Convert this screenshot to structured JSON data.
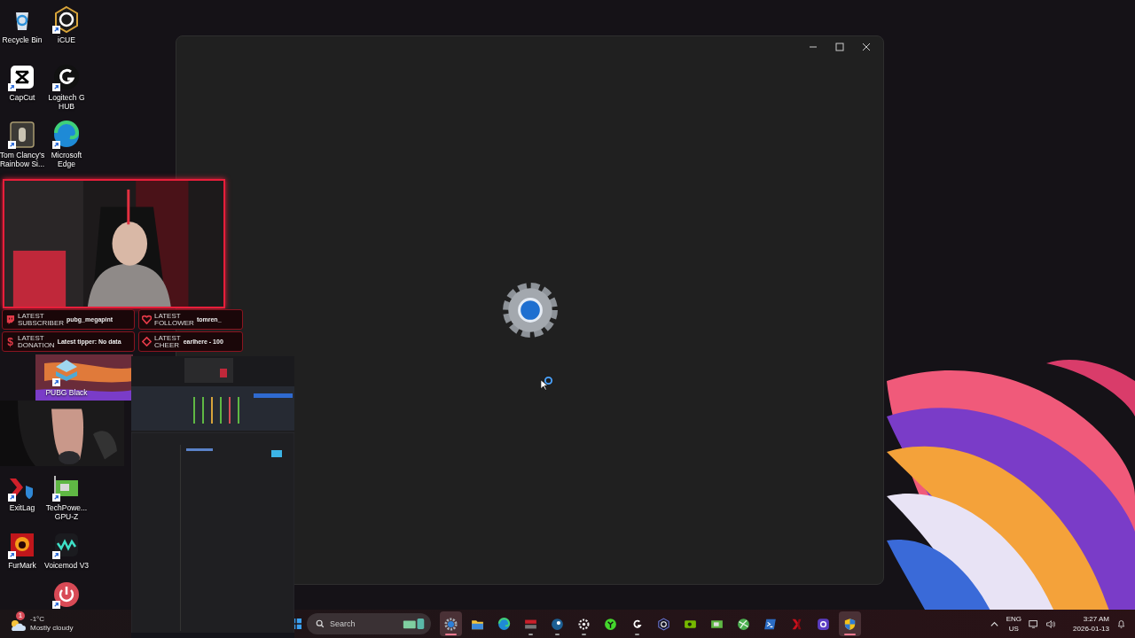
{
  "desktop_icons_top": [
    {
      "label": "Recycle Bin",
      "shortcut": false
    },
    {
      "label": "iCUE",
      "shortcut": true
    },
    {
      "label": "CapCut",
      "shortcut": true
    },
    {
      "label": "Logitech G HUB",
      "shortcut": true
    },
    {
      "label": "Tom Clancy's Rainbow Si...",
      "shortcut": true
    },
    {
      "label": "Microsoft Edge",
      "shortcut": true
    }
  ],
  "desktop_icons_bottom": [
    {
      "label": "PUBG Black",
      "shortcut": true
    },
    {
      "label": "ExitLag",
      "shortcut": true
    },
    {
      "label": "TechPowe... GPU-Z",
      "shortcut": true
    },
    {
      "label": "FurMark",
      "shortcut": true
    },
    {
      "label": "Voicemod V3",
      "shortcut": true
    },
    {
      "shortcut": true
    }
  ],
  "stream_overlay": {
    "stats": [
      {
        "kind": "twitch",
        "label": "LATEST",
        "sublabel": "SUBSCRIBER",
        "value": "pubg_megapint"
      },
      {
        "kind": "heart",
        "label": "LATEST",
        "sublabel": "FOLLOWER",
        "value": "tomren_"
      },
      {
        "kind": "symbol",
        "symbol": "$",
        "label": "LATEST",
        "sublabel": "DONATION",
        "value": "Latest tipper: No data"
      },
      {
        "kind": "diamond",
        "label": "LATEST",
        "sublabel": "CHEER",
        "value": "earlhere - 100"
      }
    ]
  },
  "window": {
    "loading": true
  },
  "taskbar": {
    "weather": {
      "badge": "1",
      "temperature": "-1°C",
      "condition": "Mostly cloudy"
    },
    "search": {
      "label": "Search"
    },
    "apps": [
      {
        "selected": true,
        "running": true
      },
      {
        "selected": false,
        "running": false
      },
      {
        "selected": false,
        "running": false
      },
      {
        "selected": false,
        "running": true
      },
      {
        "selected": false,
        "running": true
      },
      {
        "selected": false,
        "running": true
      },
      {
        "selected": false,
        "running": false
      },
      {
        "selected": false,
        "running": true
      },
      {
        "selected": false,
        "running": false
      },
      {
        "selected": false,
        "running": false
      },
      {
        "selected": false,
        "running": false
      },
      {
        "selected": false,
        "running": false
      },
      {
        "selected": false,
        "running": false
      },
      {
        "selected": false,
        "running": false
      },
      {
        "selected": false,
        "running": false
      },
      {
        "selected": true,
        "running": true
      }
    ],
    "tray": {
      "language": "ENG",
      "region": "US",
      "time": "3:27 AM",
      "date": "2026-01-13"
    }
  }
}
